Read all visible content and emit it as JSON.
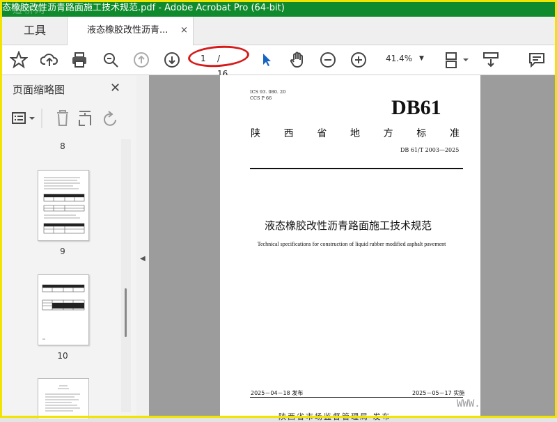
{
  "window": {
    "title": "态橡胶改性沥青路面施工技术规范.pdf - Adobe Acrobat Pro (64-bit)",
    "watermark": "道桥网"
  },
  "tabs": {
    "tools_label": "工具",
    "document_label": "液态橡胶改性沥青...",
    "close_symbol": "×"
  },
  "toolbar": {
    "icons": [
      "bookmark-star-icon",
      "cloud-upload-icon",
      "print-icon",
      "search-zoom-icon",
      "page-up-icon",
      "page-down-icon",
      "select-cursor-icon",
      "hand-tool-icon",
      "zoom-out-icon",
      "zoom-in-icon",
      "fit-page-icon",
      "scroll-mode-icon",
      "comment-icon"
    ],
    "page_current": "1",
    "page_total": "/ 16",
    "zoom_value": "41.4%",
    "annotation_color": "#d61a1a"
  },
  "sidebar": {
    "title": "页面缩略图",
    "close_symbol": "✕",
    "thumbnails": [
      {
        "label": "8"
      },
      {
        "label": "9"
      },
      {
        "label": "10"
      }
    ]
  },
  "document": {
    "ics": "ICS 93. 080. 20",
    "ccs": "CCS P 66",
    "code": "DB61",
    "province_chars": [
      "陕",
      "西",
      "省",
      "地",
      "方",
      "标",
      "准"
    ],
    "standard_number": "DB 61/T 2003—2025",
    "title_cn": "液态橡胶改性沥青路面施工技术规范",
    "title_en": "Technical specifications for construction of liquid rubber modified asphalt pavement",
    "publish_date": "2025－04－18 发布",
    "implement_date": "2025－05－17 实施",
    "publisher": "陕西省市场监督管理局 发布",
    "watermark_url": "WWW."
  },
  "colors": {
    "titlebar": "#0f8a2d",
    "border": "#f1e400",
    "cursor_blue": "#1565c0"
  }
}
